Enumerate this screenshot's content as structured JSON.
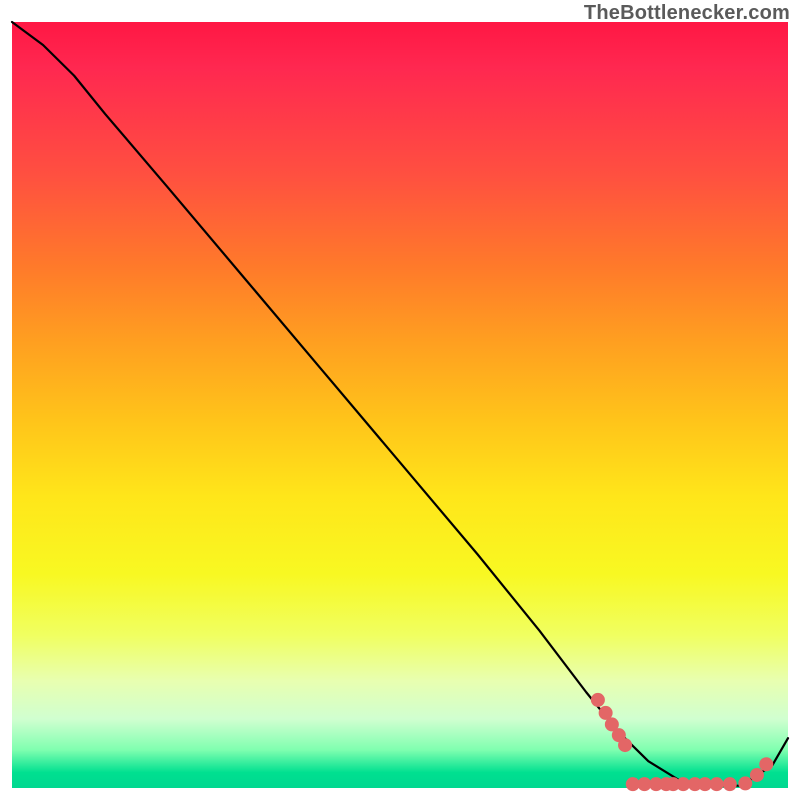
{
  "watermark": "TheBottlenecker.com",
  "chart_data": {
    "type": "line",
    "title": "",
    "xlabel": "",
    "ylabel": "",
    "xlim": [
      0,
      100
    ],
    "ylim": [
      0,
      100
    ],
    "series": [
      {
        "name": "curve",
        "x": [
          0,
          4,
          8,
          12,
          20,
          30,
          40,
          50,
          60,
          68,
          74,
          78,
          82,
          86,
          90,
          94,
          98,
          100
        ],
        "y": [
          100,
          97,
          93,
          88,
          78.5,
          66.5,
          54.5,
          42.5,
          30.5,
          20.5,
          12.5,
          7.5,
          3.5,
          1.0,
          0.3,
          0.3,
          3.0,
          6.5
        ]
      }
    ],
    "markers": [
      {
        "x": 75.5,
        "y": 11.5
      },
      {
        "x": 76.5,
        "y": 9.8
      },
      {
        "x": 77.3,
        "y": 8.3
      },
      {
        "x": 78.2,
        "y": 6.9
      },
      {
        "x": 79.0,
        "y": 5.6
      },
      {
        "x": 80.0,
        "y": 0.5
      },
      {
        "x": 81.5,
        "y": 0.5
      },
      {
        "x": 83.0,
        "y": 0.5
      },
      {
        "x": 84.3,
        "y": 0.5
      },
      {
        "x": 85.2,
        "y": 0.5
      },
      {
        "x": 86.5,
        "y": 0.5
      },
      {
        "x": 88.0,
        "y": 0.5
      },
      {
        "x": 89.3,
        "y": 0.5
      },
      {
        "x": 90.8,
        "y": 0.5
      },
      {
        "x": 92.5,
        "y": 0.5
      },
      {
        "x": 94.5,
        "y": 0.6
      },
      {
        "x": 96.0,
        "y": 1.7
      },
      {
        "x": 97.2,
        "y": 3.1
      }
    ],
    "marker_color": "#e36666",
    "curve_color": "#000000"
  }
}
